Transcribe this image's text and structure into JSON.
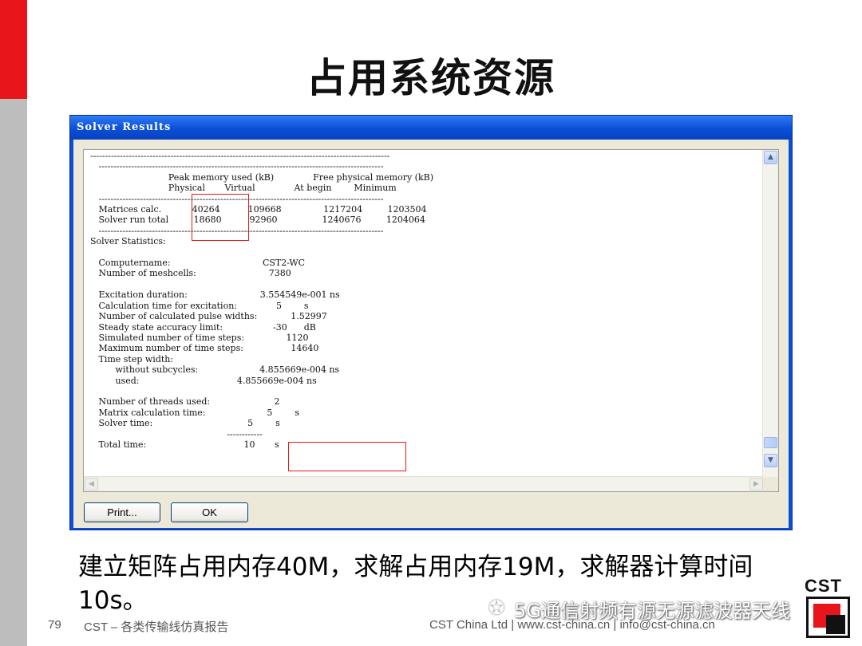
{
  "slide": {
    "title": "占用系统资源",
    "caption": "建立矩阵占用内存40M，求解占用内存19M，求解器计算时间10s。",
    "page_number": "79",
    "footer_left": "CST – 各类传输线仿真报告",
    "footer_right": "CST China Ltd | www.cst-china.cn | info@cst-china.cn",
    "watermark": "5G通信射频有源无源滤波器天线",
    "logo": "CST"
  },
  "window": {
    "title": "Solver Results",
    "log_lines": [
      "-----------------------------------------------------------------------------------------------------",
      "   ------------------------------------------------------------------------------------------------",
      "                            Peak memory used (kB)              Free physical memory (kB)",
      "                            Physical       Virtual              At begin        Minimum",
      "   ------------------------------------------------------------------------------------------------",
      "   Matrices calc.           40264          109668               1217204         1203504",
      "   Solver run total         18680          92960                1240676         1204064",
      "   ------------------------------------------------------------------------------------------------",
      "Solver Statistics:",
      "",
      "   Computername:                                 CST2-WC",
      "   Number of meshcells:                          7380",
      "",
      "   Excitation duration:                          3.554549e-001 ns",
      "   Calculation time for excitation:              5        s",
      "   Number of calculated pulse widths:            1.52997",
      "   Steady state accuracy limit:                  -30      dB",
      "   Simulated number of time steps:               1120",
      "   Maximum number of time steps:                 14640",
      "   Time step width:",
      "         without subcycles:                      4.855669e-004 ns",
      "         used:                                   4.855669e-004 ns",
      "",
      "   Number of threads used:                       2",
      "   Matrix calculation time:                      5        s",
      "   Solver time:                                  5        s",
      "                                                 ------------",
      "   Total time:                                   10       s"
    ],
    "print_button": "Print...",
    "ok_button": "OK"
  },
  "colors": {
    "accent_red": "#e8161b",
    "titlebar_blue": "#0a4fd6",
    "dialog_bg": "#ece9d8"
  }
}
